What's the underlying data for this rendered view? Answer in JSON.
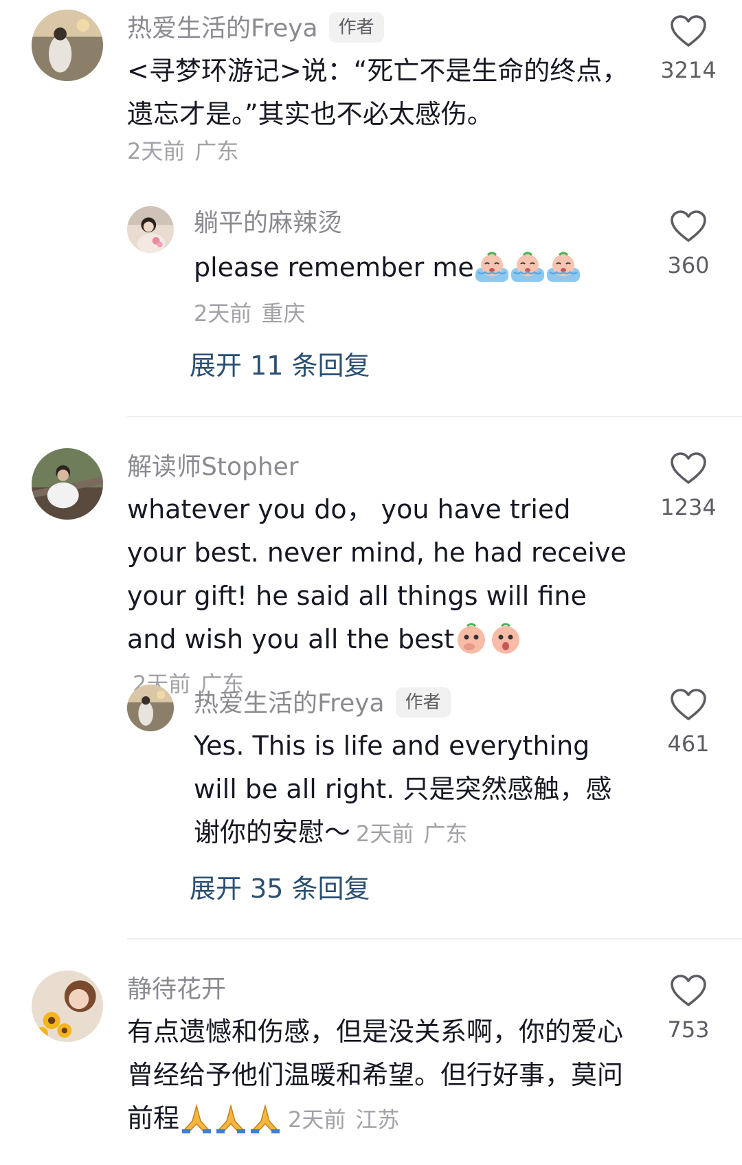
{
  "comments": [
    {
      "user": "热爱生活的Freya",
      "badge": "作者",
      "text": "<寻梦环游记>说：“死亡不是生命的终点，遗忘才是。”其实也不必太感伤。",
      "time": "2天前",
      "location": "广东",
      "likes": "3214",
      "reply": {
        "user": "躺平的麻辣烫",
        "text": "please remember me",
        "emoji": [
          "crying-bath-emoji",
          "crying-bath-emoji",
          "crying-bath-emoji"
        ],
        "time": "2天前",
        "location": "重庆",
        "likes": "360"
      },
      "expand": "展开 11 条回复"
    },
    {
      "user": "解读师Stopher",
      "text": "whatever you do， you have tried your best. never mind, he had receive your gift! he said all things will fine and wish you all the best",
      "emoji": [
        "covering-mouth-emoji",
        "shocked-emoji"
      ],
      "time": "2天前",
      "location": "广东",
      "likes": "1234",
      "reply": {
        "user": "热爱生活的Freya",
        "badge": "作者",
        "text": "Yes. This is life and everything will be all right. 只是突然感触，感谢你的安慰～",
        "time": "2天前",
        "location": "广东",
        "likes": "461"
      },
      "expand": "展开 35 条回复"
    },
    {
      "user": "静待花开",
      "text": "有点遗憾和伤感，但是没关系啊，你的爱心曾经给予他们温暖和希望。但行好事，莫问前程",
      "emoji": [
        "praying-hands-emoji",
        "praying-hands-emoji",
        "praying-hands-emoji"
      ],
      "time": "2天前",
      "location": "江苏",
      "likes": "753"
    }
  ],
  "colors": {
    "username": "#8a8b91",
    "text": "#161823",
    "meta": "#a1a2a7",
    "expand_link": "#2b4f74"
  }
}
